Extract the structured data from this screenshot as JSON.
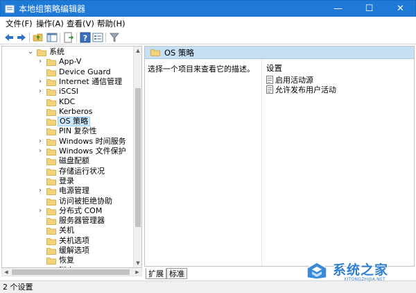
{
  "window": {
    "title": "本地组策略编辑器",
    "controls": {
      "minimize": "—",
      "maximize": "☐",
      "close": "✕"
    },
    "accent": "#1e7ad6"
  },
  "menu": [
    "文件(F)",
    "操作(A)",
    "查看(V)",
    "帮助(H)"
  ],
  "toolbar": {
    "icons": [
      "back-arrow-icon",
      "forward-arrow-icon",
      "up-folder-icon",
      "show-hide-tree-icon",
      "export-list-icon",
      "help-icon",
      "properties-icon",
      "filter-icon"
    ]
  },
  "tree": {
    "items": [
      {
        "label": "系统",
        "expander": "expanded"
      },
      {
        "label": "App-V",
        "expander": "collapsed"
      },
      {
        "label": "Device Guard",
        "expander": "none"
      },
      {
        "label": "Internet 通信管理",
        "expander": "collapsed"
      },
      {
        "label": "iSCSI",
        "expander": "collapsed"
      },
      {
        "label": "KDC",
        "expander": "none"
      },
      {
        "label": "Kerberos",
        "expander": "none"
      },
      {
        "label": "OS 策略",
        "expander": "none",
        "selected": true
      },
      {
        "label": "PIN 复杂性",
        "expander": "none"
      },
      {
        "label": "Windows 时间服务",
        "expander": "collapsed"
      },
      {
        "label": "Windows 文件保护",
        "expander": "collapsed"
      },
      {
        "label": "磁盘配额",
        "expander": "none"
      },
      {
        "label": "存储运行状况",
        "expander": "none"
      },
      {
        "label": "登录",
        "expander": "none"
      },
      {
        "label": "电源管理",
        "expander": "collapsed"
      },
      {
        "label": "访问被拒绝协助",
        "expander": "none"
      },
      {
        "label": "分布式 COM",
        "expander": "collapsed"
      },
      {
        "label": "服务器管理器",
        "expander": "none"
      },
      {
        "label": "关机",
        "expander": "none"
      },
      {
        "label": "关机选项",
        "expander": "none"
      },
      {
        "label": "缓解选项",
        "expander": "none"
      },
      {
        "label": "恢复",
        "expander": "none"
      },
      {
        "label": "脚本",
        "expander": "none"
      }
    ]
  },
  "details": {
    "header": "OS 策略",
    "description": "选择一个项目来查看它的描述。",
    "column_heading": "设置",
    "settings": [
      "启用活动源",
      "允许发布用户活动"
    ]
  },
  "tabs": [
    "扩展",
    "标准"
  ],
  "status": {
    "text": "2 个设置"
  },
  "watermark": {
    "text": "系统之家",
    "subtext": "XITONGZHIJIA.NET"
  }
}
